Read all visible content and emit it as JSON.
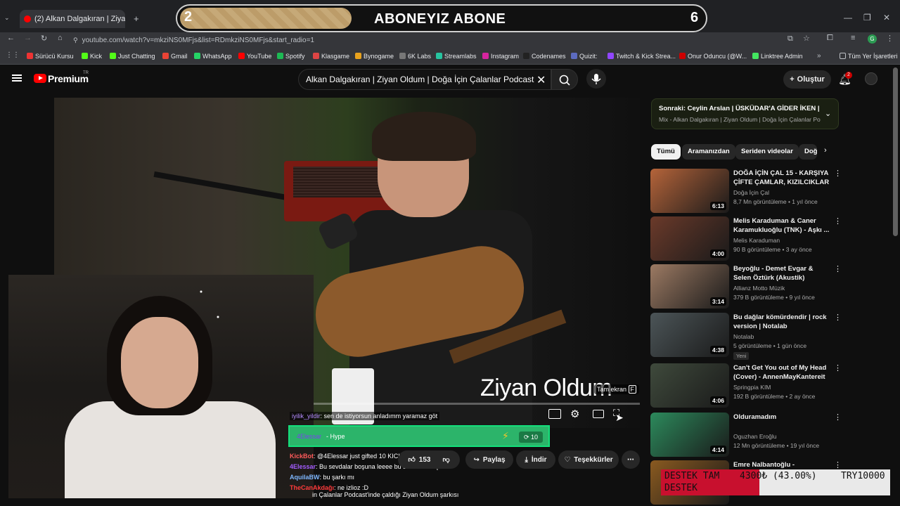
{
  "browser": {
    "tab_title": "(2) Alkan Dalgakıran | Ziyan",
    "url": "youtube.com/watch?v=mkziNS0MFjs&list=RDmkziNS0MFjs&start_radio=1",
    "bookmarks": [
      "Sürücü Kursu",
      "Kick",
      "Just Chatting",
      "Gmail",
      "WhatsApp",
      "YouTube",
      "Spotify",
      "Klasgame",
      "Bynogame",
      "6K Labs",
      "Streamlabs",
      "Instagram",
      "Codenames",
      "Quizit:",
      "Twitch & Kick Strea...",
      "Onur Oduncu (@W...",
      "Linktree Admin"
    ],
    "all_bookmarks": "Tüm Yer İşaretleri"
  },
  "overlay_banner": {
    "left_number": "2",
    "text": "ABONEYIZ ABONE",
    "right_number": "6"
  },
  "youtube": {
    "logo_text": "Premium",
    "logo_region": "TR",
    "search_value": "Alkan Dalgakıran | Ziyan Oldum | Doğa İçin Çalanlar Podcast",
    "create_label": "Oluştur",
    "notif_count": "2"
  },
  "video": {
    "overlay_title": "Ziyan Oldum",
    "fullscreen_tooltip": "Tam ekran",
    "fullscreen_key": "F"
  },
  "actions": {
    "like_count": "153",
    "share": "Paylaş",
    "download": "İndir",
    "thanks": "Teşekkürler"
  },
  "chat": {
    "line1_user": "iyilik_yildir",
    "line1_text": ": sen de istiyorsun anladımm yaramaz göt",
    "hype_user": "4Elessar",
    "hype_text": "- Hype",
    "hype_count": "10",
    "lines": [
      {
        "user": "KickBot",
        "text": ": @4Elessar just gifted 10 KICKs!",
        "color": "#ff5a5a"
      },
      {
        "user": "4Elessar",
        "text": ": Bu sevdalar boşuna leeee bu sevdalar boşuna",
        "color": "#a35cff"
      },
      {
        "user": "AquilaBW",
        "text": ": bu şarkı mı",
        "color": "#7fb7ff"
      },
      {
        "user": "TheCanAkdağı",
        "text": ": ne izlioz :D",
        "color": "#ff3b3b"
      },
      {
        "user": "",
        "text": "in Çalanlar Podcast'inde çaldığı Ziyan Oldum şarkısı",
        "color": "#ffffff"
      }
    ]
  },
  "sidebar": {
    "next_title": "Sonraki: Ceylin Arslan | ÜSKÜDAR'A GİDER İKEN | D...",
    "next_sub": "Mix - Alkan Dalgakıran | Ziyan Oldum | Doğa İçin Çalanlar Po...",
    "chips": [
      "Tümü",
      "Aramanızdan",
      "Seriden videolar",
      "Doğa"
    ],
    "videos": [
      {
        "title": "DOĞA İÇİN ÇAL 15 - KARŞIYA ÇİFTE ÇAMLAR, KIZILCIKLAR ...",
        "channel": "Doğa İçin Çal",
        "meta": "8,7 Mn görüntüleme • 1 yıl önce",
        "duration": "6:13",
        "thumb": "#b5643a"
      },
      {
        "title": "Melis Karaduman & Caner Karamukluoğlu (TNK) - Aşkı ...",
        "channel": "Melis Karaduman",
        "meta": "90 B görüntüleme • 3 ay önce",
        "duration": "4:00",
        "thumb": "#6b3a2a"
      },
      {
        "title": "Beyoğlu - Demet Evgar & Selen Öztürk (Akustik)",
        "channel": "Allianz Motto Müzik",
        "meta": "379 B görüntüleme • 9 yıl önce",
        "duration": "3:14",
        "thumb": "#9c7a63"
      },
      {
        "title": "Bu dağlar kömürdendir | rock version | Notalab",
        "channel": "Notalab",
        "meta": "5 görüntüleme • 1 gün önce",
        "duration": "4:38",
        "thumb": "#4c5558",
        "badge": "Yeni"
      },
      {
        "title": "Can't Get You out of My Head (Cover) - AnnenMayKantereit x...",
        "channel": "Springpia KIM",
        "meta": "192 B görüntüleme • 2 ay önce",
        "duration": "4:06",
        "thumb": "#3f4a3c"
      },
      {
        "title": "Olduramadım",
        "channel": "Oguzhan Eroğlu",
        "meta": "12 Mn görüntüleme • 19 yıl önce",
        "duration": "4:14",
        "thumb": "#2c8a5c"
      },
      {
        "title": "Emre Nalbantoğlu -",
        "channel": "",
        "meta": "",
        "duration": "",
        "thumb": "#8a5a20"
      }
    ]
  },
  "donation": {
    "label1": "DESTEK TAM",
    "label2": "DESTEK",
    "amount": "4300₺ (43.00%)",
    "goal": "TRY10000",
    "progress_fraction": 0.43
  }
}
